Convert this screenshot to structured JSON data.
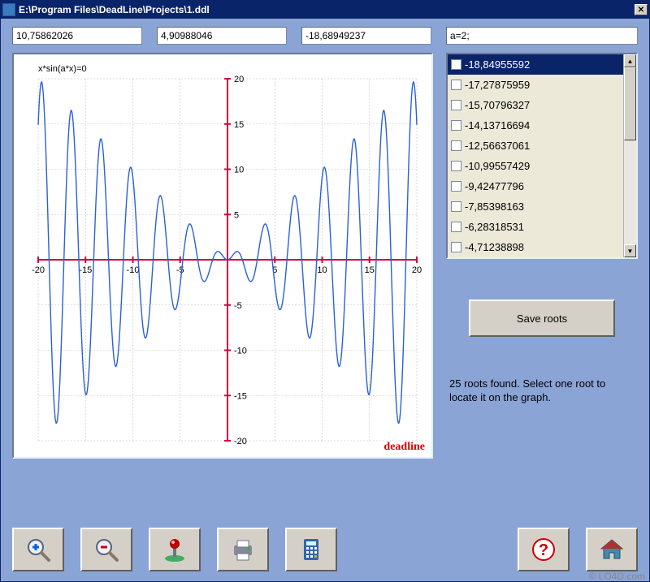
{
  "window": {
    "title": "E:\\Program Files\\DeadLine\\Projects\\1.ddl"
  },
  "inputs": {
    "v1": "10,75862026",
    "v2": "4,90988046",
    "v3": "-18,68949237",
    "params": "a=2;"
  },
  "roots_list": {
    "items": [
      {
        "label": "-18,84955592",
        "selected": true
      },
      {
        "label": "-17,27875959",
        "selected": false
      },
      {
        "label": "-15,70796327",
        "selected": false
      },
      {
        "label": "-14,13716694",
        "selected": false
      },
      {
        "label": "-12,56637061",
        "selected": false
      },
      {
        "label": "-10,99557429",
        "selected": false
      },
      {
        "label": "-9,42477796",
        "selected": false
      },
      {
        "label": "-7,85398163",
        "selected": false
      },
      {
        "label": "-6,28318531",
        "selected": false
      },
      {
        "label": "-4,71238898",
        "selected": false
      }
    ]
  },
  "buttons": {
    "save_roots": "Save roots"
  },
  "status": "25 roots found. Select one root to locate it on the graph.",
  "chart_data": {
    "type": "line",
    "title": "",
    "equation": "x*sin(a*x)=0",
    "xlabel": "",
    "ylabel": "",
    "xlim": [
      -20,
      20
    ],
    "ylim": [
      -20,
      20
    ],
    "xticks": [
      -20,
      -15,
      -10,
      -5,
      0,
      5,
      10,
      15,
      20
    ],
    "yticks": [
      -20,
      -15,
      -10,
      -5,
      0,
      5,
      10,
      15,
      20
    ],
    "formula": "y = x * sin(2*x)",
    "colors": {
      "axis": "#d4003c",
      "grid": "#c0c0c0",
      "curve": "#2a60d8"
    },
    "watermark": "deadline"
  },
  "toolbar": {
    "zoom_in": "zoom-in",
    "zoom_out": "zoom-out",
    "pan": "pan",
    "print": "print",
    "calc": "calculator",
    "help": "help",
    "home": "home"
  },
  "icons": {
    "close": "✕",
    "up": "▲",
    "down": "▼"
  },
  "attribution": "© LO4D.com"
}
